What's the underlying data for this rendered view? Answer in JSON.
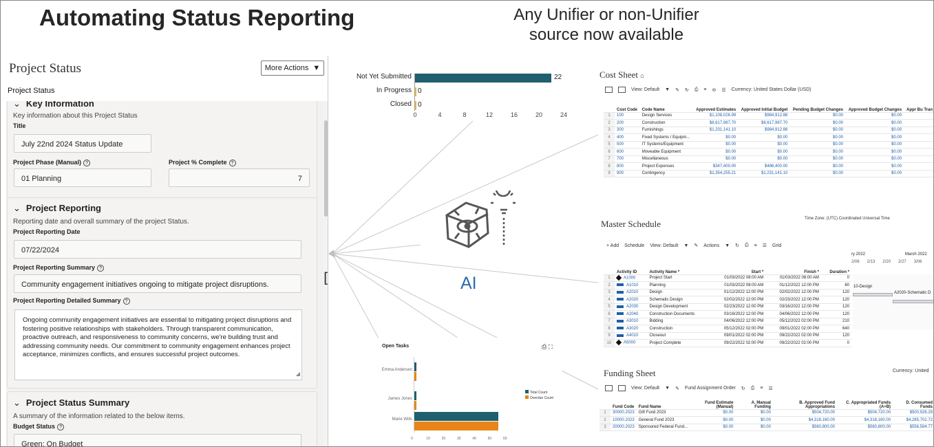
{
  "header": {
    "title": "Automating Status Reporting",
    "subtitle_line1": "Any Unifier or non-Unifier",
    "subtitle_line2": "source now available"
  },
  "left_panel": {
    "title": "Project Status",
    "more_actions": "More Actions",
    "breadcrumb": "Project Status",
    "key_info": {
      "heading": "Key Information",
      "desc": "Key information about this Project Status",
      "title_label": "Title",
      "title_value": "July 22nd 2024 Status Update",
      "phase_label": "Project Phase (Manual)",
      "phase_value": "01 Planning",
      "pct_label": "Project % Complete",
      "pct_value": "7"
    },
    "reporting": {
      "heading": "Project Reporting",
      "desc": "Reporting date and overall summary of the project Status.",
      "date_label": "Project Reporting Date",
      "date_value": "07/22/2024",
      "summary_label": "Project Reporting Summary",
      "summary_value": "Community engagement initiatives ongoing to mitigate project disruptions.",
      "detail_label": "Project Reporting Detailed Summary",
      "detail_value": "Ongoing community engagement initiatives are essential to mitigating project disruptions and fostering positive relationships with stakeholders. Through transparent communication, proactive outreach, and responsiveness to community concerns, we're building trust and addressing community needs. Our commitment to community engagement enhances project acceptance, minimizes conflicts, and ensures successful project outcomes."
    },
    "status_summary": {
      "heading": "Project Status Summary",
      "desc": "A summary of the information related to the below items.",
      "budget_label": "Budget Status",
      "budget_value": "Green: On Budget"
    }
  },
  "chart_data": [
    {
      "type": "bar",
      "orientation": "horizontal",
      "categories": [
        "Not Yet Submitted",
        "In Progress",
        "Closed"
      ],
      "values": [
        22,
        0,
        0
      ],
      "xlim": [
        0,
        24
      ],
      "xticks": [
        "0",
        "4",
        "8",
        "12",
        "16",
        "20",
        "24"
      ],
      "value_labels": [
        "22",
        "0",
        "0"
      ]
    },
    {
      "type": "bar",
      "orientation": "horizontal",
      "title": "Open Tasks",
      "categories": [
        "Emma Andersen",
        "James Jones",
        "Marie Wills"
      ],
      "series": [
        {
          "name": "Total Count",
          "values": [
            2,
            2,
            55
          ]
        },
        {
          "name": "Overdue Count",
          "values": [
            2,
            2,
            55
          ]
        }
      ],
      "xlim": [
        0,
        60
      ],
      "xticks": [
        "0",
        "10",
        "20",
        "30",
        "40",
        "50",
        "60"
      ],
      "legend": "right"
    }
  ],
  "ai_label": "AI",
  "colors": {
    "bar_primary": "#1f5f6e",
    "bar_secondary": "#e8851a",
    "ai_blue": "#2b6cb0",
    "link": "#1f5fa8"
  },
  "cost_sheet": {
    "title": "Cost Sheet",
    "view": "View: Default",
    "currency": "Currency: United States Dollar (USD)",
    "headers": [
      "Cost Code",
      "Code Name",
      "Approved Estimates",
      "Approved Initial Budget",
      "Pending Budget Changes",
      "Approved Budget Changes",
      "Appr Bu Tran"
    ],
    "rows": [
      [
        "1",
        "100",
        "Design Services",
        "$1,108,026.99",
        "$984,912.88",
        "$0.00",
        "$0.00"
      ],
      [
        "2",
        "200",
        "Construction",
        "$8,617,987.70",
        "$8,617,987.70",
        "$0.00",
        "$0.00"
      ],
      [
        "3",
        "300",
        "Furnishings",
        "$1,231,141.10",
        "$984,912.88",
        "$0.00",
        "$0.00"
      ],
      [
        "4",
        "400",
        "Fixed Systems / Equipm...",
        "$0.00",
        "$0.00",
        "$0.00",
        "$0.00"
      ],
      [
        "5",
        "500",
        "IT Systems/Equipment",
        "$0.00",
        "$0.00",
        "$0.00",
        "$0.00"
      ],
      [
        "6",
        "600",
        "Moveable Equipment",
        "$0.00",
        "$0.00",
        "$0.00",
        "$0.00"
      ],
      [
        "7",
        "700",
        "Miscellaneous",
        "$0.00",
        "$0.00",
        "$0.00",
        "$0.00"
      ],
      [
        "8",
        "800",
        "Project Expenses",
        "$347,400.00",
        "$486,400.00",
        "$0.00",
        "$0.00"
      ],
      [
        "9",
        "900",
        "Contingency",
        "$1,354,255.21",
        "$1,231,141.10",
        "$0.00",
        "$0.00"
      ]
    ]
  },
  "master_schedule": {
    "title": "Master Schedule",
    "timezone": "Time Zone: (UTC) Coordinated Universal Time",
    "toolbar": [
      "+ Add",
      "Schedule",
      "View: Default",
      "Actions",
      "Grid"
    ],
    "headers": [
      "Activity ID",
      "Activity Name *",
      "Start *",
      "Finish *",
      "Duration *"
    ],
    "months": [
      "ry 2022",
      "March 2022"
    ],
    "weeks": [
      "2/06",
      "2/13",
      "2/20",
      "2/27",
      "3/06"
    ],
    "rows": [
      [
        "1",
        "A1000",
        "Project Start",
        "01/03/2022 08:00 AM",
        "01/03/2022 08:00 AM",
        "0",
        "ms"
      ],
      [
        "2",
        "A1010",
        "Planning",
        "01/03/2022 08:00 AM",
        "01/12/2022 12:00 PM",
        "60",
        "act"
      ],
      [
        "3",
        "A2010",
        "Design",
        "01/12/2022 12:00 PM",
        "02/02/2022 12:00 PM",
        "120",
        "act"
      ],
      [
        "4",
        "A2020",
        "Schematic Design",
        "02/02/2022 12:00 PM",
        "02/23/2022 12:00 PM",
        "120",
        "act"
      ],
      [
        "5",
        "A2030",
        "Design Development",
        "02/23/2022 12:00 PM",
        "03/16/2022 12:00 PM",
        "120",
        "act"
      ],
      [
        "6",
        "A2040",
        "Construction Documents",
        "03/16/2022 12:00 PM",
        "04/06/2022 12:00 PM",
        "120",
        "act"
      ],
      [
        "7",
        "A3010",
        "Bidding",
        "04/06/2022 12:00 PM",
        "05/12/2022 02:00 PM",
        "210",
        "act"
      ],
      [
        "8",
        "A3020",
        "Construction",
        "05/12/2022 02:00 PM",
        "09/01/2022 02:00 PM",
        "640",
        "act"
      ],
      [
        "9",
        "A4010",
        "Closeout",
        "09/01/2022 02:00 PM",
        "09/22/2022 02:00 PM",
        "120",
        "act"
      ],
      [
        "10",
        "A5000",
        "Project Complete",
        "09/22/2022 02:00 PM",
        "09/22/2022 02:00 PM",
        "0",
        "ms"
      ]
    ],
    "gantt_labels": [
      "10-Design",
      "A2020-Schematic D"
    ]
  },
  "funding_sheet": {
    "title": "Funding Sheet",
    "currency": "Currency: United",
    "view": "View: Default",
    "assign_order": "Fund Assignment Order",
    "headers": [
      "Fund Code",
      "Fund Name",
      "Fund Estimate (Manual)",
      "A. Manual Funding",
      "B. Approved Fund Appropriations",
      "C. Appropriated Funds (A+B)",
      "D. Consumed Funds"
    ],
    "rows": [
      [
        "1",
        "30000.2023",
        "Gift Fund 2023",
        "$0.00",
        "$0.00",
        "$504,720.00",
        "$504,720.00",
        "$500,926.29"
      ],
      [
        "2",
        "10000.2023",
        "General Fund 2023",
        "$0.00",
        "$0.00",
        "$4,318,160.00",
        "$4,318,160.00",
        "$4,285,702.72"
      ],
      [
        "3",
        "20000.2023",
        "Sponsored Federal Fund...",
        "$0.00",
        "$0.00",
        "$560,800.00",
        "$560,800.00",
        "$556,584.77"
      ]
    ]
  }
}
